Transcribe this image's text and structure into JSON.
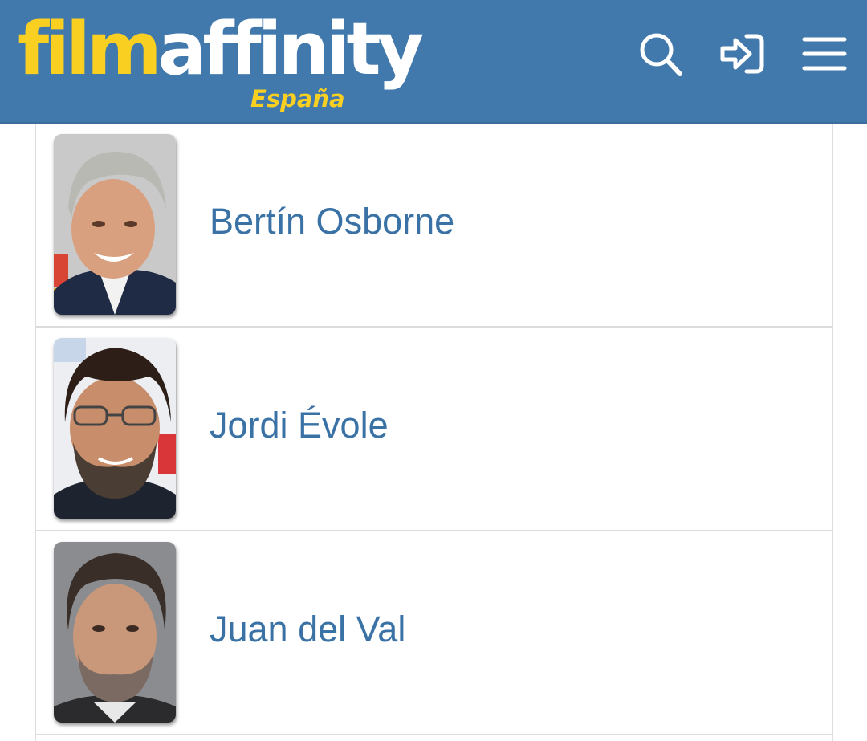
{
  "header": {
    "logo": {
      "part1": "film",
      "part2": "affinity",
      "edition": "España"
    },
    "colors": {
      "bar": "#4279ad",
      "logo_accent": "#f9d021",
      "link": "#3a72a6"
    },
    "icons": [
      "search-icon",
      "login-icon",
      "menu-icon"
    ]
  },
  "people": [
    {
      "name": "Bertín Osborne",
      "photo": "person-photo"
    },
    {
      "name": "Jordi Évole",
      "photo": "person-photo"
    },
    {
      "name": "Juan del Val",
      "photo": "person-photo"
    }
  ]
}
